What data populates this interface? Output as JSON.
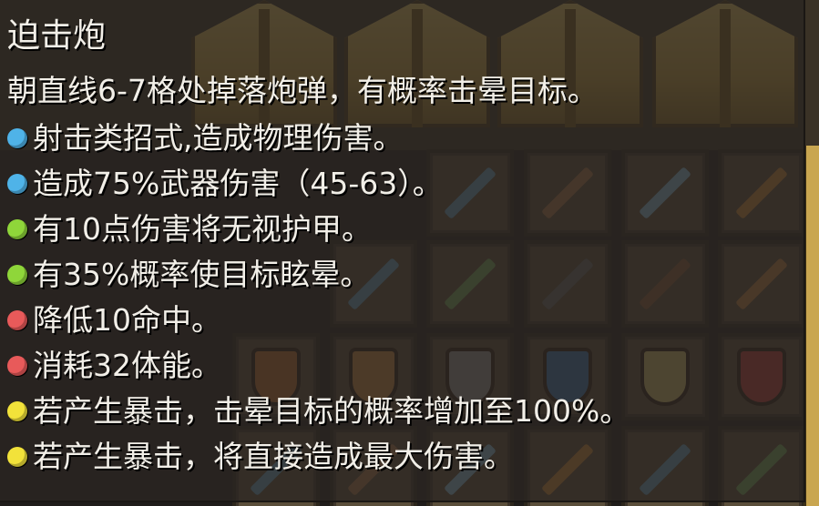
{
  "tooltip": {
    "title": "迫击炮",
    "description": "朝直线6-7格处掉落炮弹，有概率击晕目标。",
    "effects": [
      {
        "text": "射击类招式,造成物理伤害。",
        "bullet_color": "#4fb3e8",
        "bullet_icon": "blue-bullet-icon"
      },
      {
        "text": "造成75%武器伤害（45-63）。",
        "bullet_color": "#4fb3e8",
        "bullet_icon": "blue-bullet-icon"
      },
      {
        "text": "有10点伤害将无视护甲。",
        "bullet_color": "#8fd63a",
        "bullet_icon": "green-bullet-icon"
      },
      {
        "text": "有35%概率使目标眩晕。",
        "bullet_color": "#8fd63a",
        "bullet_icon": "green-bullet-icon"
      },
      {
        "text": "降低10命中。",
        "bullet_color": "#e85a5a",
        "bullet_icon": "red-bullet-icon"
      },
      {
        "text": "消耗32体能。",
        "bullet_color": "#e85a5a",
        "bullet_icon": "red-bullet-icon"
      },
      {
        "text": "若产生暴击，击晕目标的概率增加至100%。",
        "bullet_color": "#f2e23a",
        "bullet_icon": "yellow-bullet-icon"
      },
      {
        "text": "若产生暴击，将直接造成最大伤害。",
        "bullet_color": "#f2e23a",
        "bullet_icon": "yellow-bullet-icon"
      }
    ]
  },
  "inventory": {
    "items": [
      {
        "icon": "spear-icon",
        "color": "#6aa6c8"
      },
      {
        "icon": "axe-icon",
        "color": "#b07a4a"
      },
      {
        "icon": "battle-axe-icon",
        "color": "#8cc0e0"
      },
      {
        "icon": "spear-icon",
        "color": "#d08a3a"
      },
      {
        "icon": "sword-icon",
        "color": "#6aa6c8"
      },
      {
        "icon": "poleaxe-icon",
        "color": "#7ab060"
      },
      {
        "icon": "hammer-icon",
        "color": "#6a6a6a"
      },
      {
        "icon": "crossbow-icon",
        "color": "#8a5a3a"
      },
      {
        "icon": "sword-icon",
        "color": "#c08040"
      },
      {
        "icon": "shield-icon",
        "color": "#c07030"
      },
      {
        "icon": "shield-icon",
        "color": "#d08a40"
      },
      {
        "icon": "shield-icon",
        "color": "#9a9a9a"
      },
      {
        "icon": "shield-icon",
        "color": "#3a78b8"
      },
      {
        "icon": "shield-icon",
        "color": "#d8c070"
      },
      {
        "icon": "shield-icon",
        "color": "#c03a3a"
      }
    ]
  }
}
